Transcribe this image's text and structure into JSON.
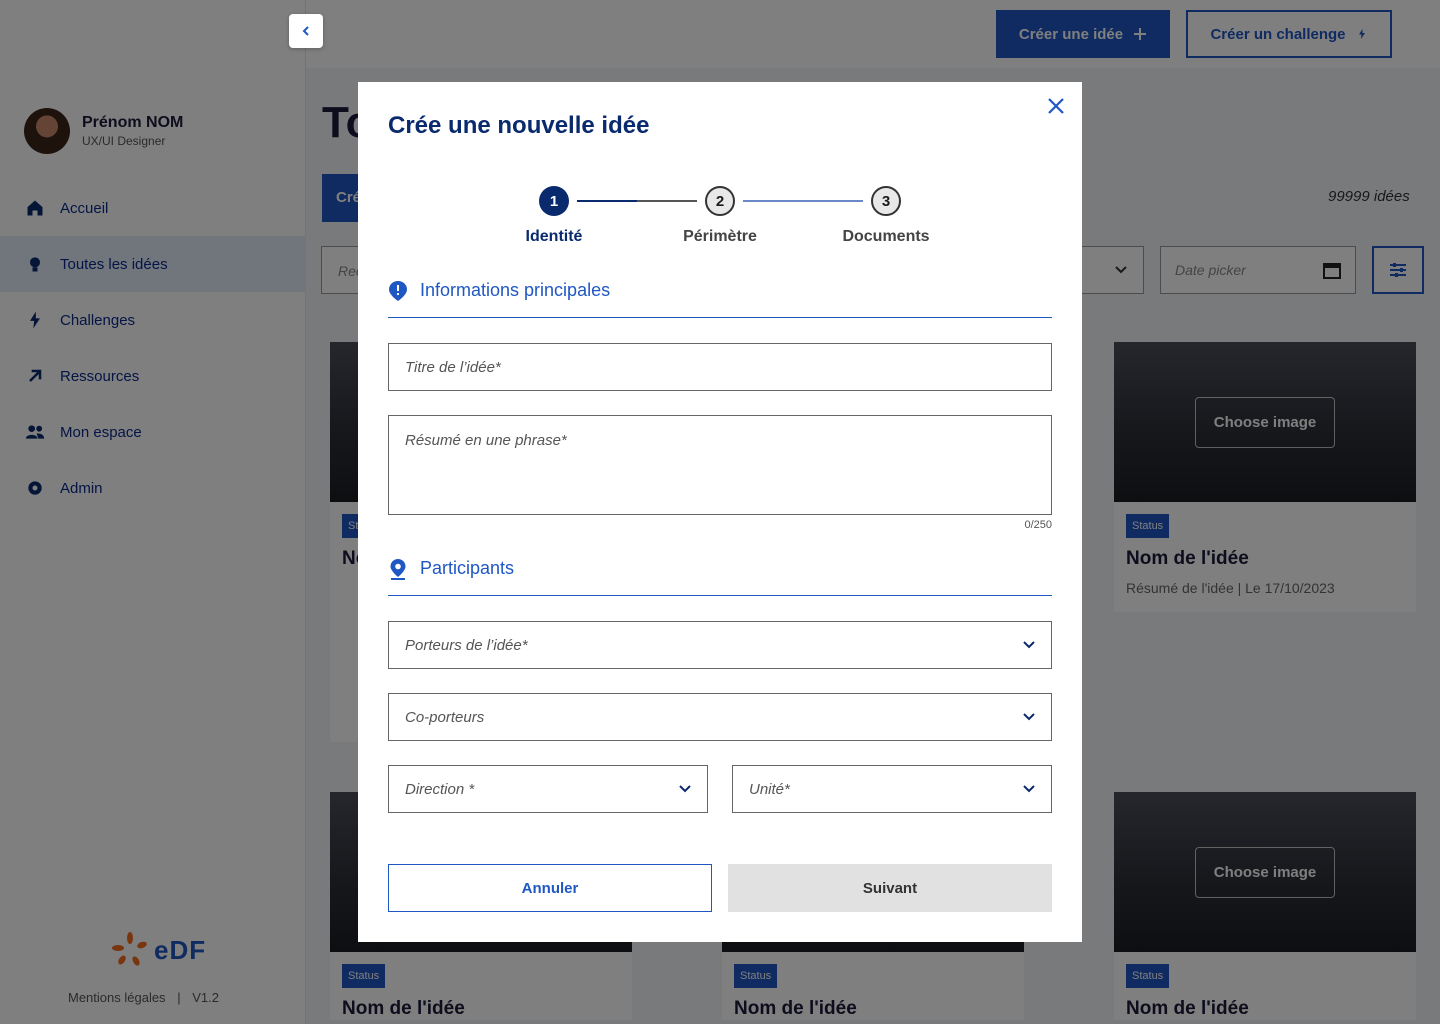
{
  "sidebar": {
    "profile": {
      "name": "Prénom NOM",
      "role": "UX/UI Designer"
    },
    "items": [
      {
        "label": "Accueil",
        "icon": "home-icon"
      },
      {
        "label": "Toutes les idées",
        "icon": "lightbulb-icon"
      },
      {
        "label": "Challenges",
        "icon": "bolt-icon"
      },
      {
        "label": "Ressources",
        "icon": "arrow-up-right-icon"
      },
      {
        "label": "Mon espace",
        "icon": "people-icon"
      },
      {
        "label": "Admin",
        "icon": "gear-icon"
      }
    ],
    "logo": "eDF",
    "footer": {
      "legal": "Mentions légales",
      "separator": "|",
      "version": "V1.2"
    }
  },
  "header": {
    "create_idea": "Créer une idée",
    "create_challenge": "Créer un challenge"
  },
  "main": {
    "title": "To",
    "cta_partial": "Cré",
    "count": "99999  idées",
    "search_partial": "Rec",
    "date_placeholder": "Date picker"
  },
  "cards": {
    "choose_image": "Choose image",
    "status": "Status",
    "title": "Nom de l'idée",
    "meta": "Résumé de l'idée | Le 17/10/2023"
  },
  "modal": {
    "title": "Crée une nouvelle idée",
    "steps": [
      {
        "number": "1",
        "label": "Identité"
      },
      {
        "number": "2",
        "label": "Périmètre"
      },
      {
        "number": "3",
        "label": "Documents"
      }
    ],
    "section_main": "Informations principales",
    "title_placeholder": "Titre de l’idée*",
    "summary_placeholder": "Résumé en une phrase*",
    "summary_counter": "0/250",
    "section_participants": "Participants",
    "carriers_placeholder": "Porteurs de l’idée*",
    "co_carriers_placeholder": "Co-porteurs",
    "direction_placeholder": "Direction *",
    "unit_placeholder": "Unité*",
    "cancel": "Annuler",
    "next": "Suivant"
  },
  "colors": {
    "brand": "#1f57c3",
    "navy": "#0a2a6e",
    "disabled": "#e1e1e1"
  }
}
